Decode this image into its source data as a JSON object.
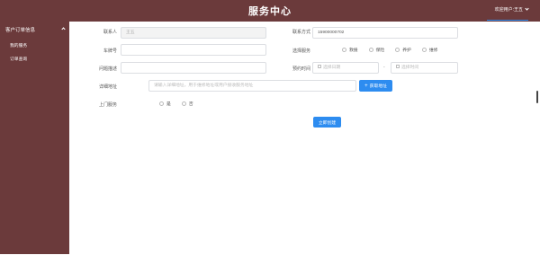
{
  "header": {
    "title": "服务中心",
    "user_label": "欢迎用户:王五"
  },
  "sidebar": {
    "group_label": "客户订单信息",
    "items": [
      {
        "label": "我的服务"
      },
      {
        "label": "订单查询"
      }
    ]
  },
  "form": {
    "contact": {
      "label": "联系人",
      "value": "王五"
    },
    "phone": {
      "label": "联系方式",
      "value": "15900000702"
    },
    "plate": {
      "label": "车牌号",
      "value": ""
    },
    "service": {
      "label": "选择服务",
      "options": [
        "救援",
        "保险",
        "养护",
        "维修"
      ]
    },
    "problem": {
      "label": "问题描述",
      "value": ""
    },
    "appointment": {
      "label": "预约时间",
      "start_placeholder": "选择日期",
      "separator": "-",
      "end_placeholder": "选择时间"
    },
    "address": {
      "label": "详细地址",
      "placeholder": "请输入详细地址，用于维修地址或用户接收服务地址",
      "locate_button": "获取地址"
    },
    "onsite": {
      "label": "上门服务",
      "options": [
        "是",
        "否"
      ]
    },
    "submit_label": "立即创建"
  },
  "colors": {
    "brand": "#6b3a3b",
    "accent": "#2d8cf0"
  }
}
